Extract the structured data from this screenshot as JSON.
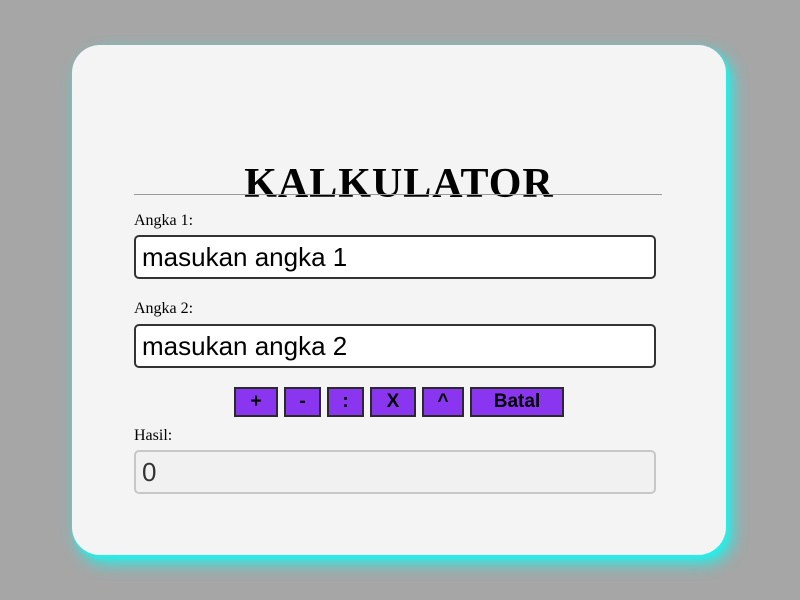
{
  "app": {
    "title": "KALKULATOR"
  },
  "form": {
    "angka1_label": "Angka 1:",
    "angka1_placeholder": "masukan angka 1",
    "angka2_label": "Angka 2:",
    "angka2_placeholder": "masukan angka 2",
    "hasil_label": "Hasil:",
    "hasil_value": "0"
  },
  "buttons": {
    "add": "+",
    "subtract": "-",
    "divide": ":",
    "multiply": "X",
    "power": "^",
    "cancel": "Batal"
  },
  "colors": {
    "page_background": "#a6a6a6",
    "card_background": "#f4f4f4",
    "card_glow": "#23f0ea",
    "button_background": "#8a35f0"
  }
}
